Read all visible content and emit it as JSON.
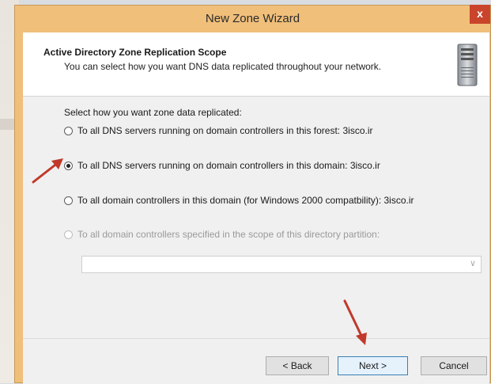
{
  "window": {
    "title": "New Zone Wizard",
    "close_glyph": "x"
  },
  "header": {
    "title": "Active Directory Zone Replication Scope",
    "subtitle": "You can select how you want DNS data replicated throughout your network."
  },
  "body": {
    "prompt": "Select how you want zone data replicated:",
    "options": [
      {
        "label": "To all DNS servers running on domain controllers in this forest: 3isco.ir",
        "checked": false,
        "enabled": true
      },
      {
        "label": "To all DNS servers running on domain controllers in this domain: 3isco.ir",
        "checked": true,
        "enabled": true
      },
      {
        "label": "To all domain controllers in this domain (for Windows 2000 compatbility): 3isco.ir",
        "checked": false,
        "enabled": true
      },
      {
        "label": "To all domain controllers specified in the scope of this directory partition:",
        "checked": false,
        "enabled": false
      }
    ],
    "partition_select": {
      "value": ""
    }
  },
  "buttons": {
    "back": "< Back",
    "next": "Next >",
    "cancel": "Cancel"
  },
  "annotations": {
    "arrow_color": "#c0392b",
    "icons": [
      "server-icon",
      "red-arrow-icon"
    ]
  }
}
